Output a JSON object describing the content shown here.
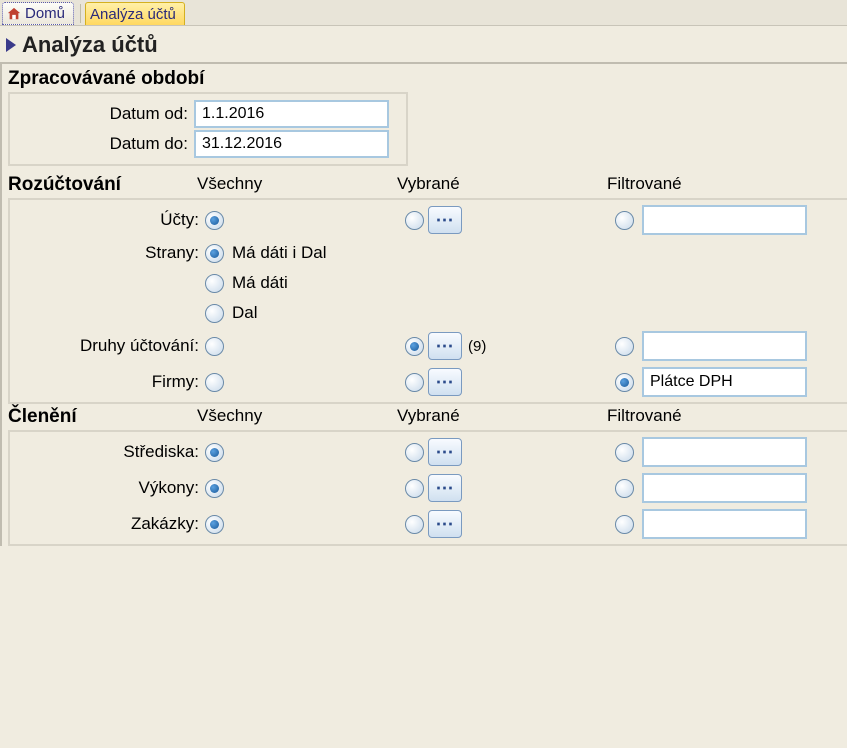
{
  "tabs": {
    "home": "Domů",
    "active": "Analýza účtů"
  },
  "title": "Analýza účtů",
  "period": {
    "header": "Zpracovávané období",
    "from_label": "Datum od:",
    "from_value": "1.1.2016",
    "to_label": "Datum do:",
    "to_value": "31.12.2016"
  },
  "cols": {
    "all": "Všechny",
    "selected": "Vybrané",
    "filtered": "Filtrované"
  },
  "sections": {
    "rozuctovani": "Rozúčtování",
    "cleneni": "Členění"
  },
  "rows": {
    "ucty": "Účty:",
    "strany": "Strany:",
    "druhy": "Druhy účtování:",
    "firmy": "Firmy:",
    "strediska": "Střediska:",
    "vykony": "Výkony:",
    "zakazky": "Zakázky:"
  },
  "sides": {
    "both": "Má dáti i Dal",
    "md": "Má dáti",
    "dal": "Dal"
  },
  "druhy_count": "(9)",
  "firmy_filter": "Plátce DPH"
}
